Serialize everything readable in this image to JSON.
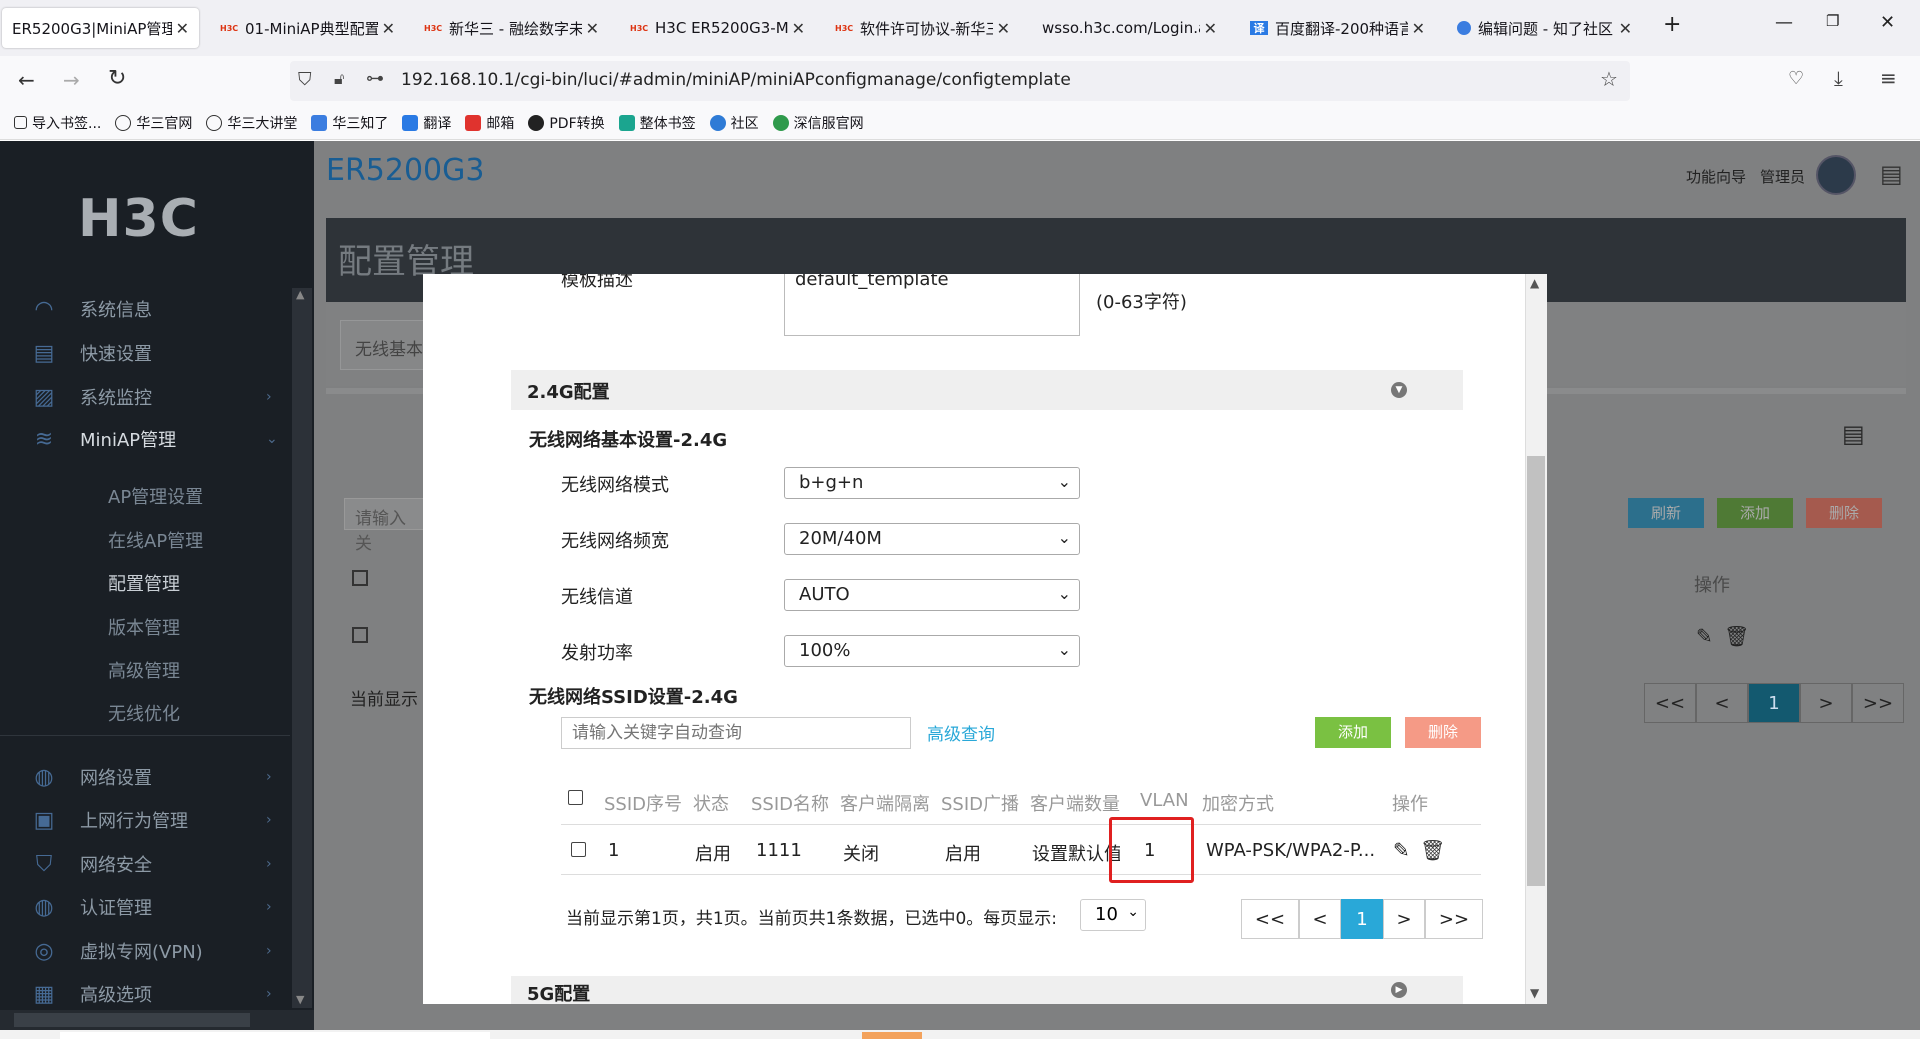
{
  "browser": {
    "tabs": [
      {
        "label": "ER5200G3|MiniAP管理|",
        "active": true,
        "favicon": ""
      },
      {
        "label": "01-MiniAP典型配置",
        "favicon": "H3C"
      },
      {
        "label": "新华三 - 融绘数字未",
        "favicon": "H3C"
      },
      {
        "label": "H3C ER5200G3-MI",
        "favicon": "H3C"
      },
      {
        "label": "软件许可协议-新华三",
        "favicon": "H3C"
      },
      {
        "label": "wsso.h3c.com/Login.a",
        "favicon": ""
      },
      {
        "label": "百度翻译-200种语言",
        "favicon": "译"
      },
      {
        "label": "编辑问题 - 知了社区",
        "favicon": ""
      }
    ],
    "url": "192.168.10.1/cgi-bin/luci/#admin/miniAP/miniAPconfigmanage/configtemplate",
    "bookmarks": [
      "导入书签...",
      "华三官网",
      "华三大讲堂",
      "华三知了",
      "翻译",
      "邮箱",
      "PDF转换",
      "整体书签",
      "社区",
      "深信服官网"
    ]
  },
  "sidebar": {
    "logo": "H3C",
    "menu": [
      {
        "label": "系统信息",
        "icon": "gauge-icon"
      },
      {
        "label": "快速设置",
        "icon": "document-icon"
      },
      {
        "label": "系统监控",
        "icon": "chart-icon"
      },
      {
        "label": "MiniAP管理",
        "icon": "wifi-icon"
      },
      {
        "label": "网络设置",
        "icon": "globe-icon"
      },
      {
        "label": "上网行为管理",
        "icon": "behavior-icon"
      },
      {
        "label": "网络安全",
        "icon": "shield-icon"
      },
      {
        "label": "认证管理",
        "icon": "globe-user-icon"
      },
      {
        "label": "虚拟专网(VPN)",
        "icon": "vpn-icon"
      },
      {
        "label": "高级选项",
        "icon": "grid-icon"
      }
    ],
    "submenu": [
      "AP管理设置",
      "在线AP管理",
      "配置管理",
      "版本管理",
      "高级管理",
      "无线优化"
    ]
  },
  "header": {
    "app_title": "ER5200G3",
    "wizard": "功能向导",
    "admin": "管理员",
    "page_title": "配置管理"
  },
  "background": {
    "tab1": "无线基本",
    "search_placeholder": "请输入关",
    "refresh": "刷新",
    "add": "添加",
    "delete": "删除",
    "ops_header": "操作",
    "status_prefix": "当前显示",
    "pager": [
      "<<",
      "<",
      "1",
      ">",
      ">>"
    ]
  },
  "modal": {
    "template_desc_label": "模板描述",
    "template_desc_value": "default_template",
    "char_hint": "(0-63字符)",
    "section_24": "2.4G配置",
    "basic_head": "无线网络基本设置-2.4G",
    "fields": [
      {
        "label": "无线网络模式",
        "value": "b+g+n"
      },
      {
        "label": "无线网络频宽",
        "value": "20M/40M"
      },
      {
        "label": "无线信道",
        "value": "AUTO"
      },
      {
        "label": "发射功率",
        "value": "100%"
      }
    ],
    "ssid_head": "无线网络SSID设置-2.4G",
    "search_placeholder": "请输入关键字自动查询",
    "advanced_query": "高级查询",
    "add": "添加",
    "delete": "删除",
    "columns": [
      "SSID序号",
      "状态",
      "SSID名称",
      "客户端隔离",
      "SSID广播",
      "客户端数量",
      "VLAN",
      "加密方式",
      "操作"
    ],
    "row": {
      "index": "1",
      "status": "启用",
      "name": "1111",
      "isolation": "关闭",
      "broadcast": "启用",
      "clients": "设置默认值",
      "vlan": "1",
      "encryption": "WPA-PSK/WPA2-P..."
    },
    "status_text": "当前显示第1页，共1页。当前页共1条数据，已选中0。每页显示:",
    "per_page": "10",
    "pager": [
      "<<",
      "<",
      "1",
      ">",
      ">>"
    ],
    "section_5g": "5G配置"
  },
  "colors": {
    "accent": "#29a8d8",
    "add_green": "#7ac142",
    "delete_red": "#f59a86",
    "highlight_red": "#e02020",
    "brand_blue": "#195d93"
  }
}
